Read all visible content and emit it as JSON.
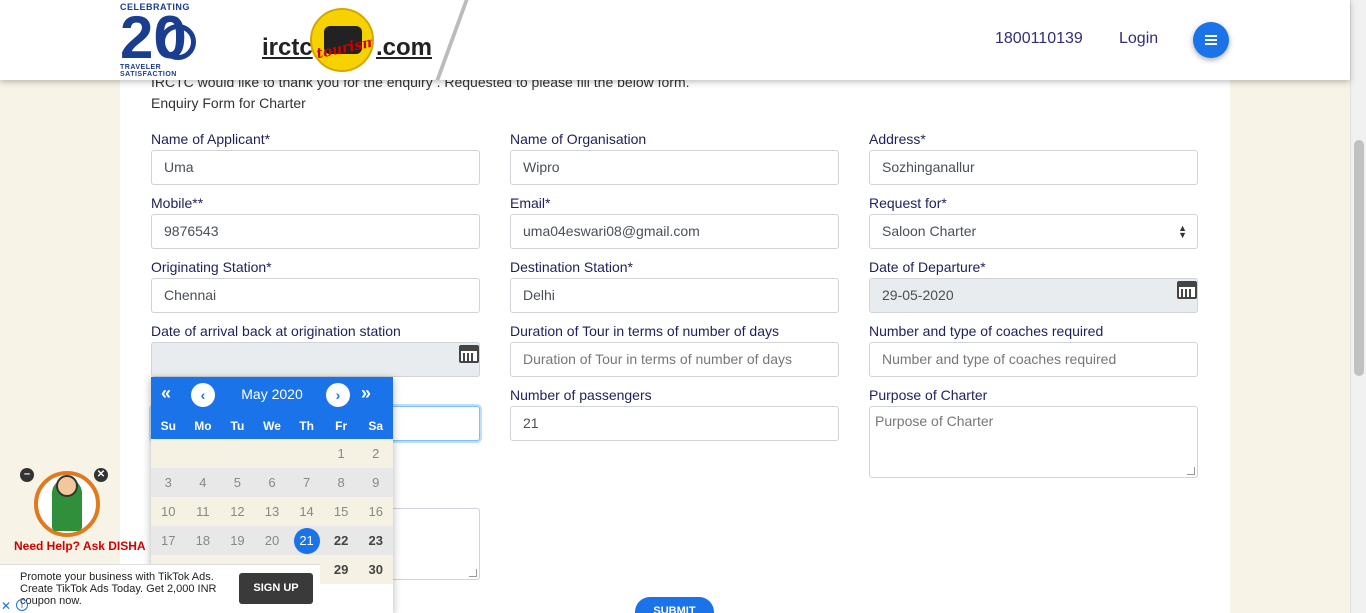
{
  "header": {
    "badge_top": "CELEBRATING",
    "badge_number": "20",
    "badge_bottom": "TRAVELER SATISFACTION",
    "brand_left": "irctc",
    "brand_right": ".com",
    "tourism_script": "tourism",
    "phone": "1800110139",
    "login": "Login"
  },
  "intro": "IRCTC would like to thank you for the enquiry . Requested to please fill the below form.",
  "form_title": "Enquiry Form for Charter",
  "fields": {
    "applicant": {
      "label": "Name of Applicant*",
      "value": "Uma"
    },
    "organisation": {
      "label": "Name of Organisation",
      "value": "Wipro"
    },
    "address": {
      "label": "Address*",
      "value": "Sozhinganallur"
    },
    "mobile": {
      "label": "Mobile**",
      "value": "9876543"
    },
    "email": {
      "label": "Email*",
      "value": "uma04eswari08@gmail.com"
    },
    "request_for": {
      "label": "Request for*",
      "value": "Saloon Charter"
    },
    "origin": {
      "label": "Originating Station*",
      "value": "Chennai"
    },
    "destination": {
      "label": "Destination Station*",
      "value": "Delhi"
    },
    "departure": {
      "label": "Date of Departure*",
      "value": "29-05-2020"
    },
    "arrival": {
      "label": "Date of arrival back at origination station",
      "value": ""
    },
    "duration": {
      "label": "Duration of Tour in terms of number of days",
      "placeholder": "Duration of Tour in terms of number of days"
    },
    "coaches": {
      "label": "Number and type of coaches required",
      "placeholder": "Number and type of coaches required"
    },
    "passengers": {
      "label": "Number of passengers",
      "value": "21"
    },
    "purpose": {
      "label": "Purpose of Charter",
      "placeholder": "Purpose of Charter"
    }
  },
  "datepicker": {
    "month": "May 2020",
    "days": [
      "Su",
      "Mo",
      "Tu",
      "We",
      "Th",
      "Fr",
      "Sa"
    ],
    "week1": [
      "",
      "",
      "",
      "",
      "",
      "1",
      "2"
    ],
    "week2": [
      "3",
      "4",
      "5",
      "6",
      "7",
      "8",
      "9"
    ],
    "week3": [
      "10",
      "11",
      "12",
      "13",
      "14",
      "15",
      "16"
    ],
    "week4": [
      "17",
      "18",
      "19",
      "20",
      "21",
      "22",
      "23"
    ],
    "week5": [
      "29",
      "30"
    ],
    "selected": "21"
  },
  "disha": {
    "text": "Need Help? Ask DISHA"
  },
  "ad": {
    "text": "Promote your business with TikTok Ads. Create TikTok Ads Today. Get 2,000 INR coupon now.",
    "button": "SIGN UP"
  },
  "submit": "SUBMIT"
}
